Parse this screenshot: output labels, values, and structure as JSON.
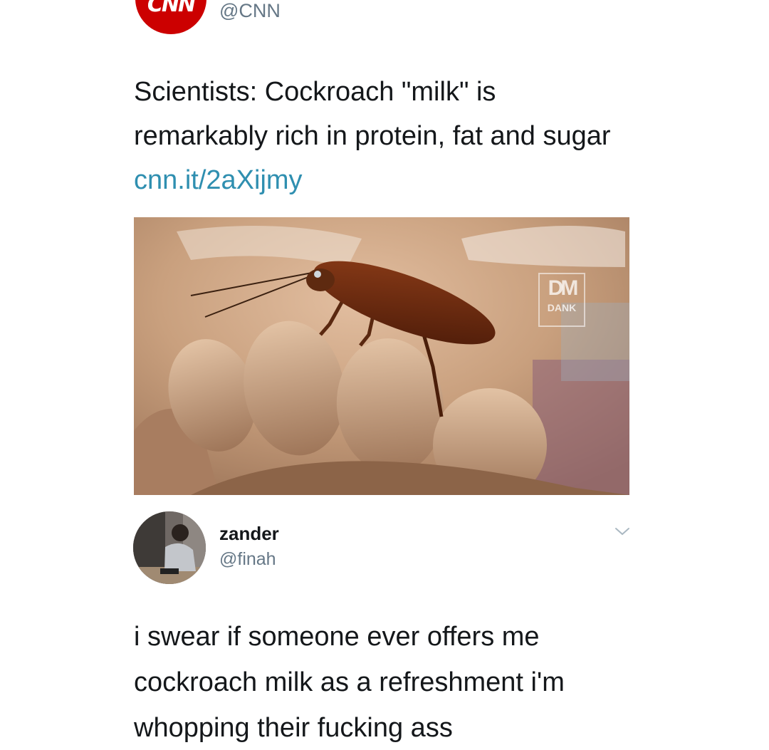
{
  "quoted_tweet": {
    "account_handle": "@CNN",
    "avatar_logo_text": "CNN",
    "avatar_color": "#cc0000",
    "text": "Scientists: Cockroach \"milk\" is remarkably rich in protein, fat and sugar ",
    "link_text": "cnn.it/2aXijmy",
    "link_color": "#2f8fb0",
    "image": {
      "icon": "cockroach-on-fingers-photo",
      "watermark_text": "DANK"
    }
  },
  "reply": {
    "display_name": "zander",
    "handle": "@finah",
    "text": "i swear if someone ever offers me cockroach milk as a refreshment i'm whopping their fucking ass",
    "menu_icon": "chevron-down-icon"
  }
}
